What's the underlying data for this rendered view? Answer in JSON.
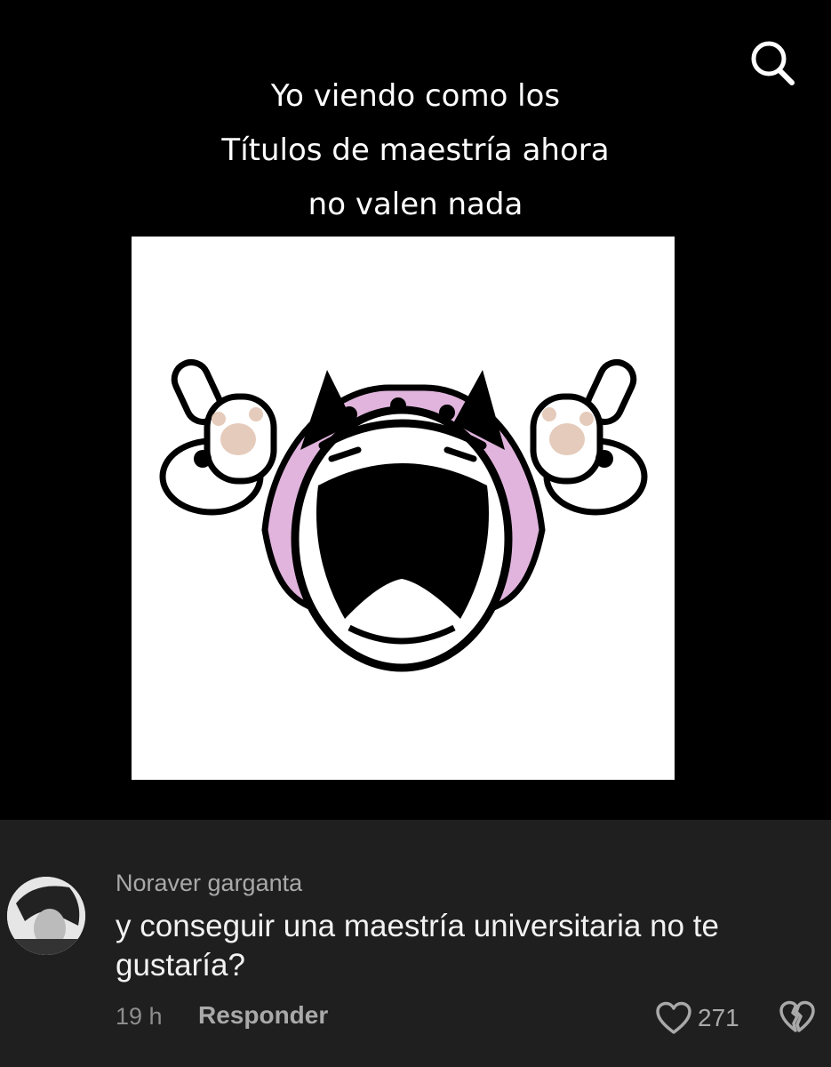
{
  "video": {
    "caption_lines": [
      "Yo viendo como los",
      "Títulos de maestría ahora",
      "no valen nada"
    ],
    "search_icon": "search-icon",
    "meme_colors": {
      "ears": "#e0b4dc",
      "paw_pads": "#e5cbbb",
      "outline": "#000000"
    }
  },
  "comment": {
    "author": "Noraver garganta",
    "text": "y conseguir una maestría universitaria no te gustaría?",
    "time": "19 h",
    "reply_label": "Responder",
    "like_count": "271",
    "like_icon": "heart-outline-icon",
    "dislike_icon": "broken-heart-icon"
  },
  "colors": {
    "background": "#000000",
    "comment_panel": "#1f1f1f",
    "muted_text": "#a9a9a9",
    "text": "#f2f2f2"
  }
}
